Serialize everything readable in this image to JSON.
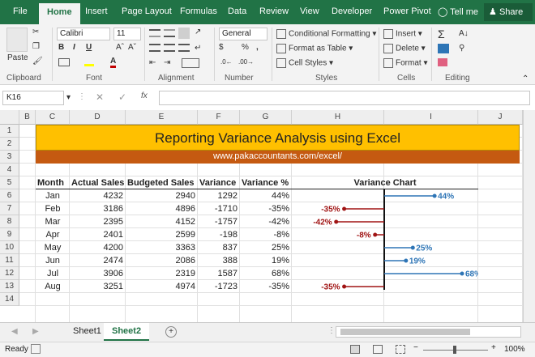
{
  "ribbon_tabs": [
    {
      "label": "File",
      "name": "tab-file"
    },
    {
      "label": "Home",
      "name": "tab-home"
    },
    {
      "label": "Insert",
      "name": "tab-insert"
    },
    {
      "label": "Page Layout",
      "name": "tab-page-layout"
    },
    {
      "label": "Formulas",
      "name": "tab-formulas"
    },
    {
      "label": "Data",
      "name": "tab-data"
    },
    {
      "label": "Review",
      "name": "tab-review"
    },
    {
      "label": "View",
      "name": "tab-view"
    },
    {
      "label": "Developer",
      "name": "tab-developer"
    },
    {
      "label": "Power Pivot",
      "name": "tab-power-pivot"
    },
    {
      "label": "Tell me",
      "name": "tell-me"
    }
  ],
  "share_label": "Share",
  "ribbon": {
    "paste_label": "Paste",
    "font_name": "Calibri",
    "font_size": "11",
    "number_format": "General",
    "conditional_formatting": "Conditional Formatting",
    "format_as_table": "Format as Table",
    "cell_styles": "Cell Styles",
    "insert_label": "Insert",
    "delete_label": "Delete",
    "format_label": "Format",
    "groups": {
      "clipboard": "Clipboard",
      "font": "Font",
      "alignment": "Alignment",
      "number": "Number",
      "styles": "Styles",
      "cells": "Cells",
      "editing": "Editing"
    }
  },
  "namebox": "K16",
  "columns": [
    "B",
    "C",
    "D",
    "E",
    "F",
    "G",
    "H",
    "I",
    "J"
  ],
  "rows": [
    "1",
    "2",
    "3",
    "4",
    "5",
    "6",
    "7",
    "8",
    "9",
    "10",
    "11",
    "12",
    "13",
    "14"
  ],
  "title": "Reporting Variance Analysis using Excel",
  "url": "www.pakaccountants.com/excel/",
  "table": {
    "headers": [
      "Month",
      "Actual Sales",
      "Budgeted Sales",
      "Variance",
      "Variance %"
    ],
    "rows": [
      [
        "Jan",
        "4232",
        "2940",
        "1292",
        "44%"
      ],
      [
        "Feb",
        "3186",
        "4896",
        "-1710",
        "-35%"
      ],
      [
        "Mar",
        "2395",
        "4152",
        "-1757",
        "-42%"
      ],
      [
        "Apr",
        "2401",
        "2599",
        "-198",
        "-8%"
      ],
      [
        "May",
        "4200",
        "3363",
        "837",
        "25%"
      ],
      [
        "Jun",
        "2474",
        "2086",
        "388",
        "19%"
      ],
      [
        "Jul",
        "3906",
        "2319",
        "1587",
        "68%"
      ],
      [
        "Aug",
        "3251",
        "4974",
        "-1723",
        "-35%"
      ]
    ]
  },
  "chart_data": {
    "type": "bar",
    "title": "Variance Chart",
    "categories": [
      "Jan",
      "Feb",
      "Mar",
      "Apr",
      "May",
      "Jun",
      "Jul",
      "Aug"
    ],
    "values": [
      44,
      -35,
      -42,
      -8,
      25,
      19,
      68,
      -35
    ],
    "labels": [
      "44%",
      "-35%",
      "-42%",
      "-8%",
      "25%",
      "19%",
      "68%",
      "-35%"
    ],
    "colors": {
      "positive": "#2e75b6",
      "negative": "#a01414"
    }
  },
  "colors": {
    "excel_green": "#217346",
    "title_fill": "#ffc000",
    "url_band": "#c55a11"
  },
  "sheets": [
    {
      "label": "Sheet1",
      "active": false
    },
    {
      "label": "Sheet2",
      "active": true
    }
  ],
  "status": {
    "ready": "Ready",
    "zoom": "100%"
  }
}
